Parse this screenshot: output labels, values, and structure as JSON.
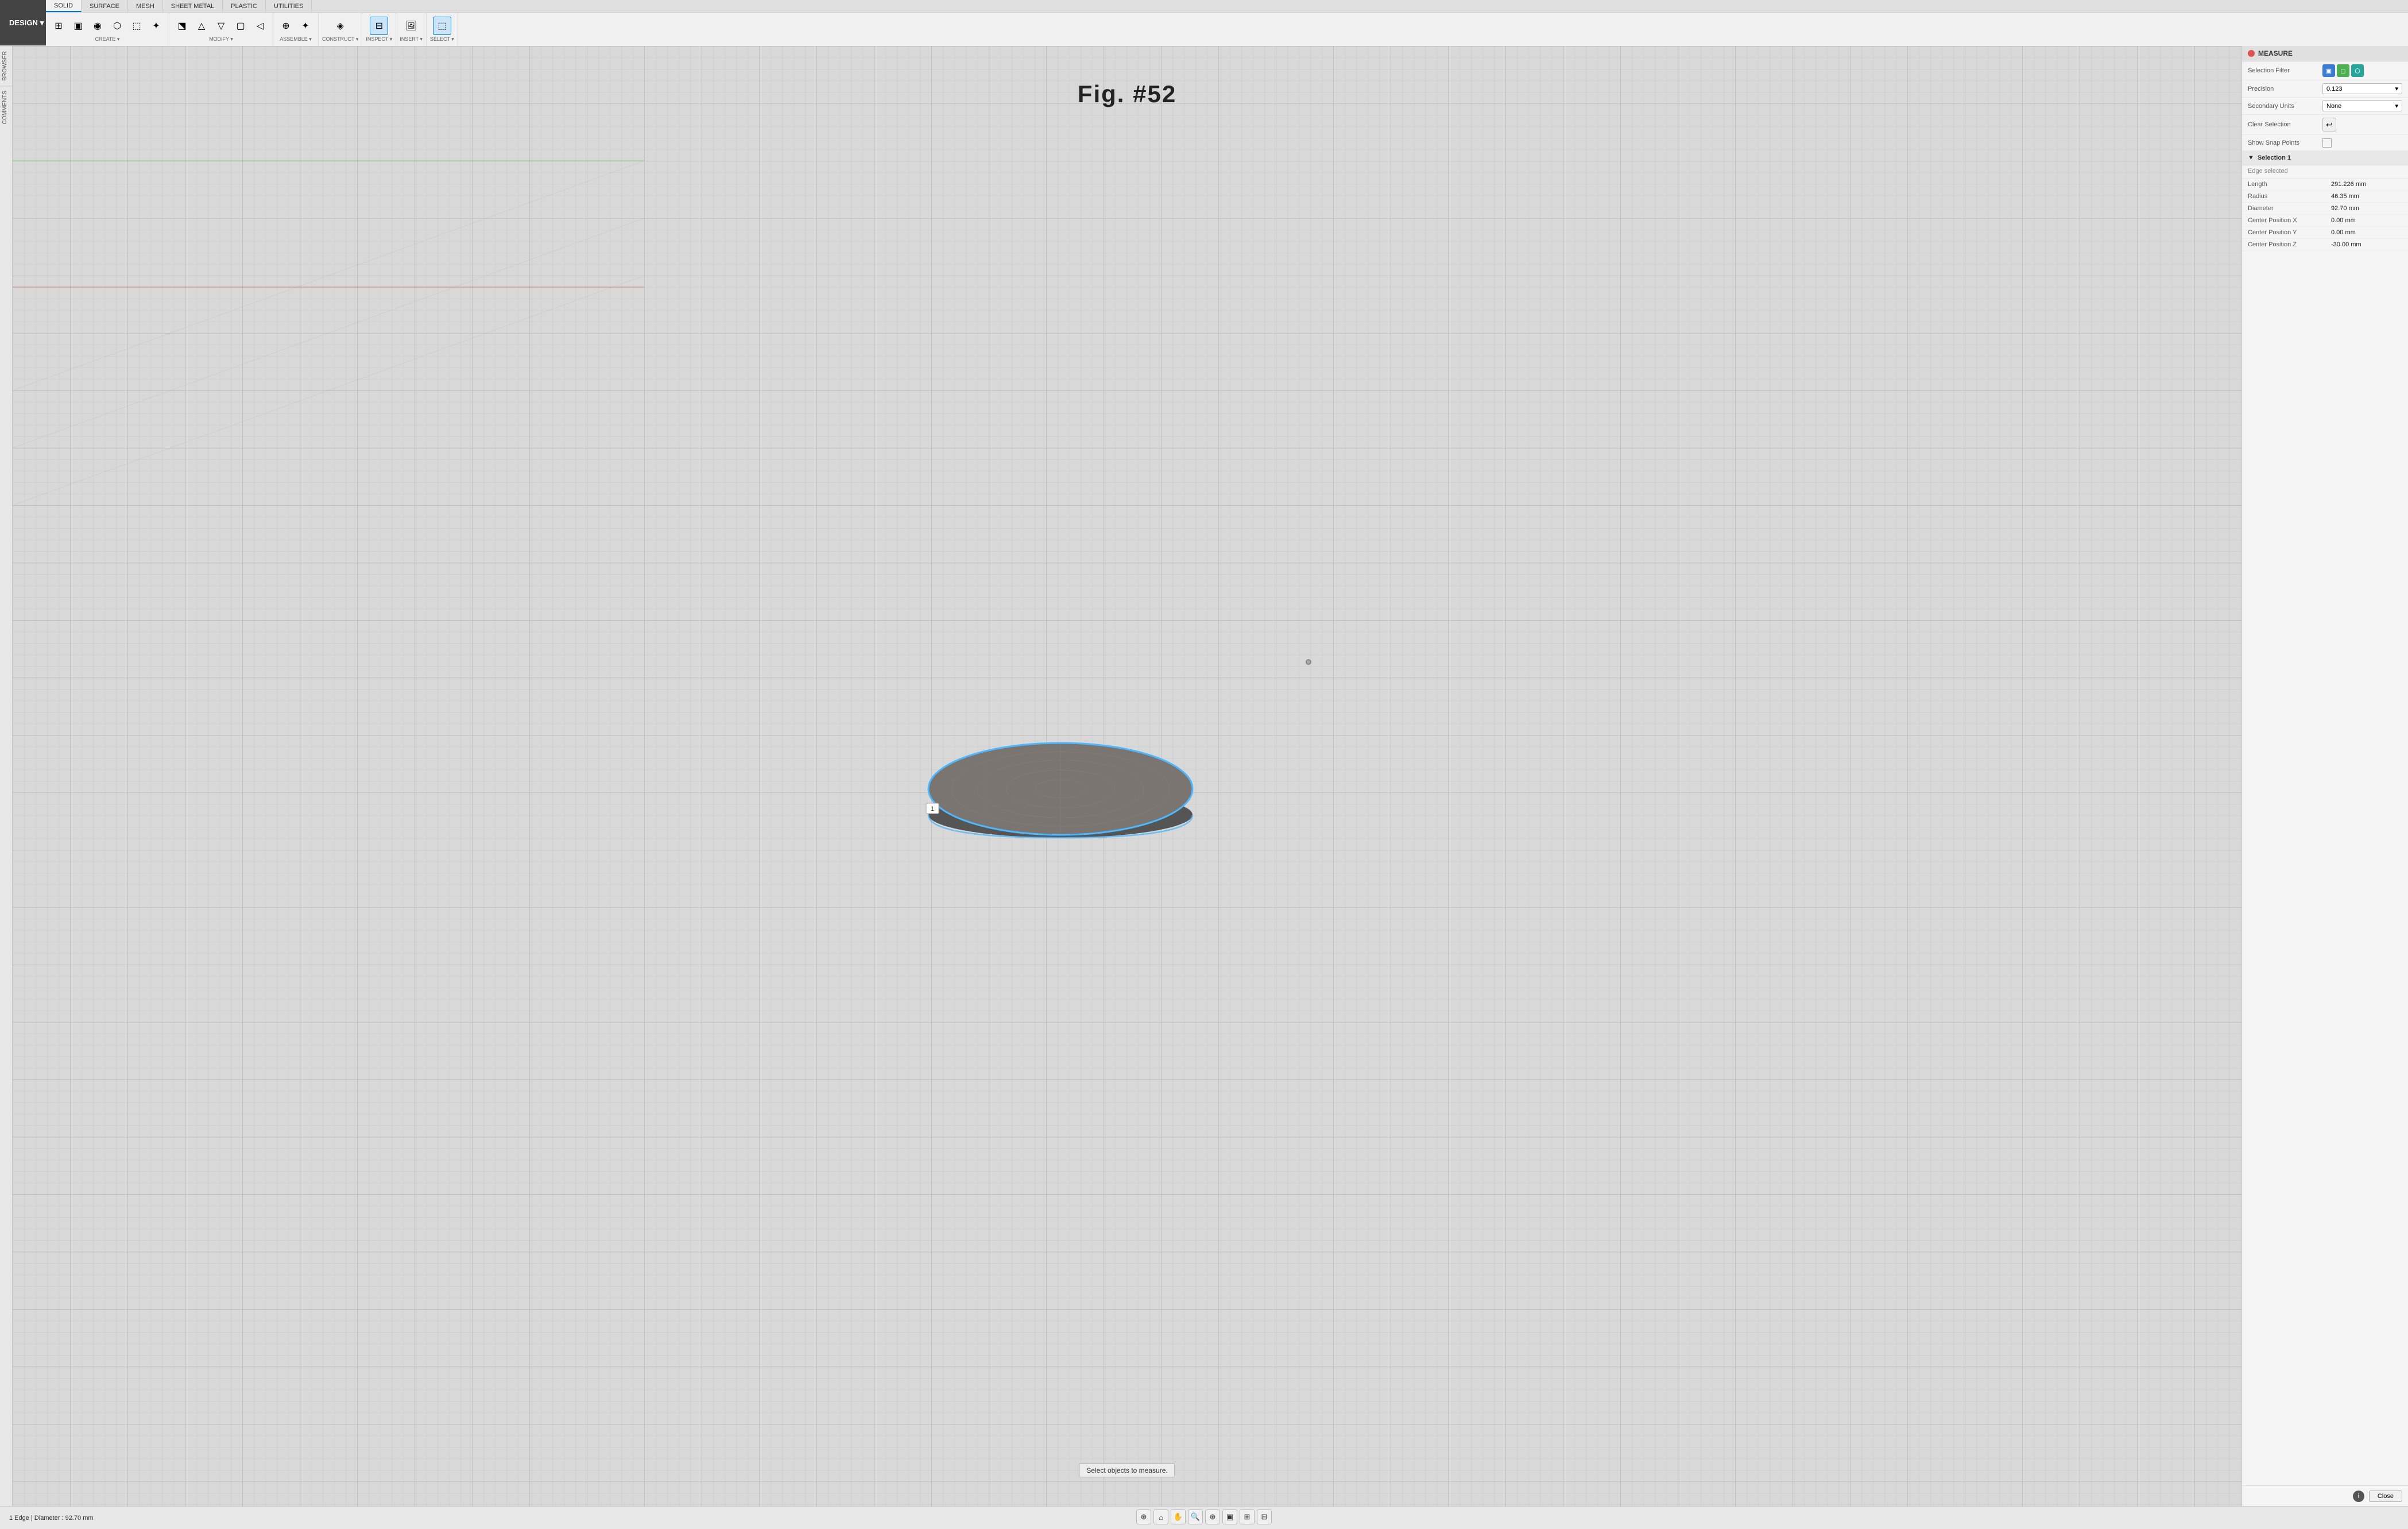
{
  "app": {
    "design_label": "DESIGN",
    "design_arrow": "▾"
  },
  "tabs": [
    {
      "label": "SOLID",
      "active": true
    },
    {
      "label": "SURFACE",
      "active": false
    },
    {
      "label": "MESH",
      "active": false
    },
    {
      "label": "SHEET METAL",
      "active": false
    },
    {
      "label": "PLASTIC",
      "active": false
    },
    {
      "label": "UTILITIES",
      "active": false
    }
  ],
  "toolbar_groups": [
    {
      "name": "CREATE",
      "has_arrow": true,
      "icons": [
        "⊞",
        "▣",
        "◎",
        "⬡",
        "⬚",
        "✦"
      ]
    },
    {
      "name": "MODIFY",
      "has_arrow": true,
      "icons": [
        "⬔",
        "△",
        "▽",
        "▢",
        "◁"
      ]
    },
    {
      "name": "ASSEMBLE",
      "has_arrow": true,
      "icons": [
        "⊕",
        "✦"
      ]
    },
    {
      "name": "CONSTRUCT",
      "has_arrow": true,
      "icons": [
        "◈"
      ]
    },
    {
      "name": "INSPECT",
      "has_arrow": true,
      "icons": [
        "⊟"
      ],
      "active": true
    },
    {
      "name": "INSERT",
      "has_arrow": true,
      "icons": [
        "🖼"
      ]
    },
    {
      "name": "SELECT",
      "has_arrow": true,
      "icons": [
        "⬚"
      ],
      "active": true
    }
  ],
  "side_tabs": [
    "BROWSER",
    "COMMENTS"
  ],
  "figure_label": "Fig.  #52",
  "viewport": {
    "select_message": "Select objects to measure."
  },
  "measure_panel": {
    "title": "MEASURE",
    "selection_filter_label": "Selection Filter",
    "precision_label": "Precision",
    "precision_value": "0.123",
    "secondary_units_label": "Secondary Units",
    "secondary_units_value": "None",
    "clear_selection_label": "Clear Selection",
    "show_snap_points_label": "Show Snap Points",
    "selection1_label": "Selection 1",
    "edge_selected_text": "Edge selected",
    "measurements": [
      {
        "label": "Length",
        "value": "291.226 mm"
      },
      {
        "label": "Radius",
        "value": "46.35 mm"
      },
      {
        "label": "Diameter",
        "value": "92.70 mm"
      },
      {
        "label": "Center Position X",
        "value": "0.00 mm"
      },
      {
        "label": "Center Position Y",
        "value": "0.00 mm"
      },
      {
        "label": "Center Position Z",
        "value": "-30.00 mm"
      }
    ],
    "close_btn_label": "Close"
  },
  "statusbar": {
    "right_text": "1 Edge | Diameter : 92.70 mm"
  }
}
